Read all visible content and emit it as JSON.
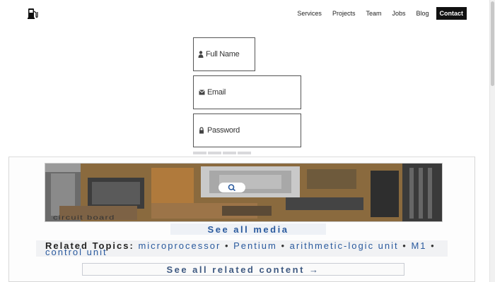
{
  "header": {
    "logo_icon": "gas-pump-icon",
    "nav": [
      {
        "label": "Services"
      },
      {
        "label": "Projects"
      },
      {
        "label": "Team"
      },
      {
        "label": "Jobs"
      },
      {
        "label": "Blog"
      },
      {
        "label": "Contact"
      }
    ]
  },
  "form": {
    "full_name": {
      "placeholder": "Full Name",
      "value": "",
      "icon": "user-icon"
    },
    "email": {
      "placeholder": "Email",
      "value": "",
      "icon": "envelope-icon"
    },
    "password": {
      "placeholder": "Password",
      "value": "",
      "icon": "lock-icon"
    }
  },
  "media": {
    "caption": "circuit board",
    "zoom_icon": "magnifier-icon",
    "see_all_media": "See all media",
    "related_label": "Related Topics:",
    "related_topics": [
      {
        "label": "microprocessor"
      },
      {
        "label": "Pentium"
      },
      {
        "label": "arithmetic-logic unit"
      },
      {
        "label": "M1"
      },
      {
        "label": "control unit"
      }
    ],
    "topic_separator": "•",
    "see_all_related": "See all related content →"
  },
  "colors": {
    "link": "#2a5a9e",
    "contact_bg": "#111111",
    "field_border": "#555555"
  }
}
